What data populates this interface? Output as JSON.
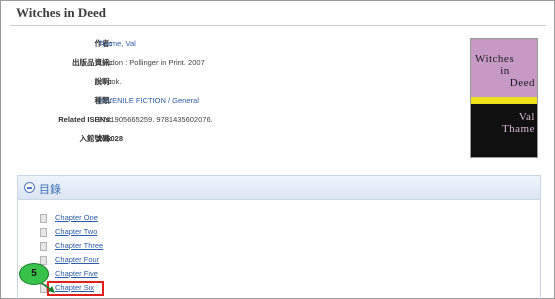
{
  "page": {
    "title": "Witches in Deed"
  },
  "metadata": [
    {
      "label": "作者:",
      "value": "Thame, Val",
      "style": "link"
    },
    {
      "label": "出版品資訊:",
      "value": "London : Pollinger in Print. 2007",
      "style": "plain"
    },
    {
      "label": "說明:",
      "value": "eBook.",
      "style": "plain"
    },
    {
      "label": "種類:",
      "value": "JUVENILE FICTION / General",
      "style": "link"
    },
    {
      "label": "Related ISBNs:",
      "value": "9781905665259. 9781435602076.",
      "style": "plain"
    },
    {
      "label": "入館號碼:",
      "value": "206028",
      "style": "bold"
    }
  ],
  "cover": {
    "title_line1": "Witches",
    "title_line2": "in",
    "title_line3": "Deed",
    "author_line1": "Val",
    "author_line2": "Thame"
  },
  "toc": {
    "heading": "目錄",
    "chapters": [
      "Chapter One",
      "Chapter Two",
      "Chapter Three",
      "Chapter Four",
      "Chapter Five",
      "Chapter Six"
    ]
  },
  "annotation": {
    "step_number": "5"
  },
  "colors": {
    "link": "#2b5da8",
    "highlight": "#e2201b",
    "badge": "#37c24a",
    "toc_header": "#dbe6f3"
  }
}
